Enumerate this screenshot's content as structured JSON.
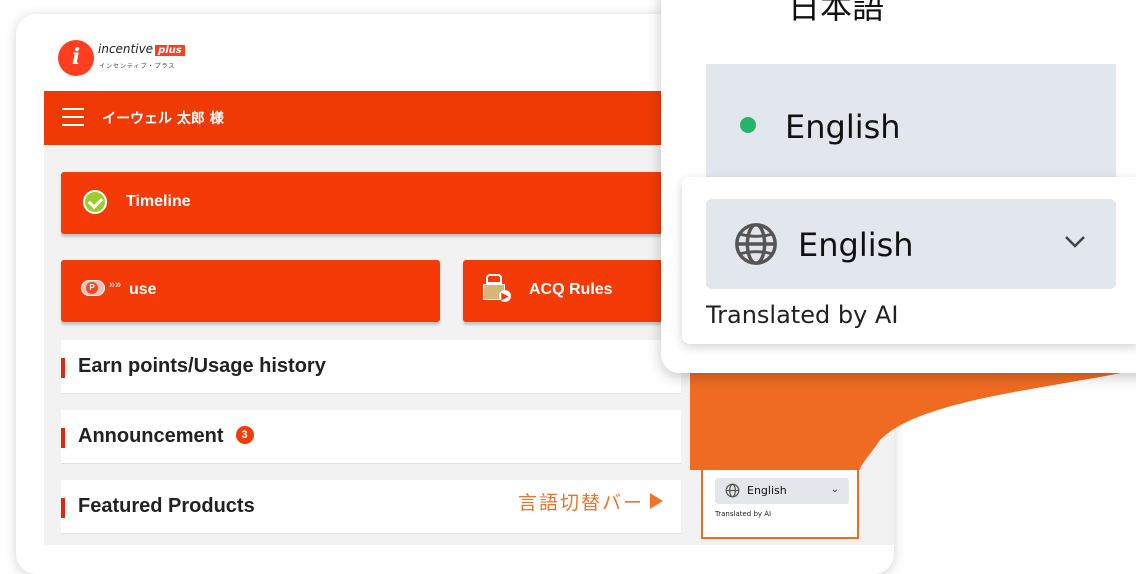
{
  "brand": {
    "name": "incentive",
    "name_plus": "plus",
    "subtitle": "インセンティブ・プラス"
  },
  "header": {
    "user_name": "イーウェル 太郎 様"
  },
  "buttons": {
    "timeline": "Timeline",
    "use": "use",
    "acq_rules": "ACQ Rules"
  },
  "sections": {
    "earn_points": "Earn points/Usage history",
    "announcement": "Announcement",
    "announcement_count": "3",
    "featured_products": "Featured Products"
  },
  "annotation": {
    "language_bar_caption": "言語切替バー"
  },
  "language_switcher": {
    "options": [
      {
        "label": "日本語",
        "selected": false
      },
      {
        "label": "English",
        "selected": true
      }
    ],
    "selected_label": "English",
    "translated_note": "Translated by AI"
  },
  "colors": {
    "brand_red": "#f03a06",
    "callout_orange": "#ef6b22",
    "selected_dot": "#26b36b"
  },
  "icons": [
    "hamburger-menu-icon",
    "check-circle-icon",
    "points-icon",
    "gift-icon",
    "globe-icon",
    "chevron-down-icon",
    "arrow-right-icon"
  ]
}
